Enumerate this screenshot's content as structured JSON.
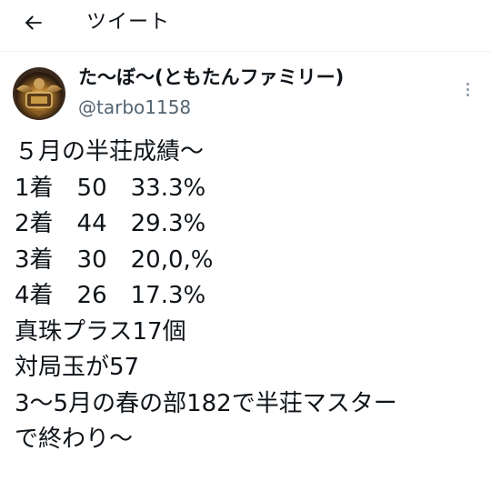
{
  "header": {
    "back_icon": "arrow-left-icon",
    "title": "ツイート"
  },
  "author": {
    "avatar_icon": "avatar",
    "display_name": "た〜ぼ〜(ともたんファミリー)",
    "handle": "@tarbo1158",
    "more_icon": "more-vertical-icon"
  },
  "tweet": {
    "lines": [
      "５月の半荘成績〜",
      "1着　50　33.3%",
      "2着　44　29.3%",
      "3着　30　20,0,%",
      "4着　26　17.3%",
      "真珠プラス17個",
      "対局玉が57",
      "3〜5月の春の部182で半荘マスター",
      "で終わり〜"
    ]
  },
  "colors": {
    "text_primary": "#0f1419",
    "text_secondary": "#536471",
    "divider": "#eff3f4"
  }
}
